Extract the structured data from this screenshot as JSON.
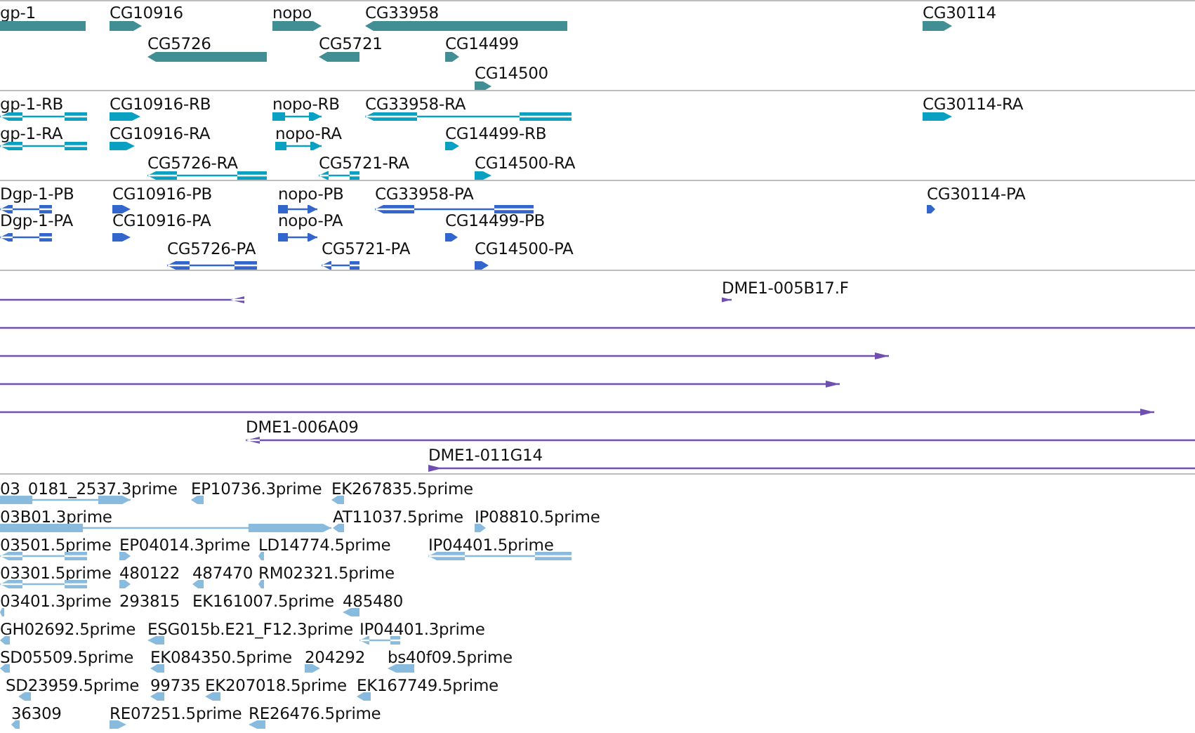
{
  "tracks": [
    {
      "kind": "genes",
      "color": "#418e94",
      "features": [
        {
          "label": "gp-1"
        },
        {
          "label": "CG10916",
          "reverse_strand": false
        },
        {
          "label": "nopo",
          "reverse_strand": false
        },
        {
          "label": "CG33958",
          "reverse_strand": true
        },
        {
          "label": "CG30114",
          "reverse_strand": false
        },
        {
          "label": "CG5726",
          "reverse_strand": true
        },
        {
          "label": "CG5721",
          "reverse_strand": true
        },
        {
          "label": "CG14499",
          "reverse_strand": false
        },
        {
          "label": "CG14500",
          "reverse_strand": false
        }
      ]
    },
    {
      "kind": "transcripts",
      "color": "#0aa0c2",
      "features": [
        {
          "label": "gp-1-RB",
          "reverse_strand": true
        },
        {
          "label": "CG10916-RB",
          "reverse_strand": false
        },
        {
          "label": "nopo-RB",
          "reverse_strand": false
        },
        {
          "label": "CG33958-RA",
          "reverse_strand": true
        },
        {
          "label": "CG30114-RA",
          "reverse_strand": false
        },
        {
          "label": "gp-1-RA",
          "reverse_strand": true
        },
        {
          "label": "CG10916-RA",
          "reverse_strand": false
        },
        {
          "label": "nopo-RA",
          "reverse_strand": false
        },
        {
          "label": "CG14499-RB",
          "reverse_strand": false
        },
        {
          "label": "CG5726-RA",
          "reverse_strand": true
        },
        {
          "label": "CG5721-RA",
          "reverse_strand": true
        },
        {
          "label": "CG14500-RA",
          "reverse_strand": false
        }
      ]
    },
    {
      "kind": "proteins",
      "color": "#3366cc",
      "features": [
        {
          "label": "Dgp-1-PB",
          "reverse_strand": true
        },
        {
          "label": "CG10916-PB",
          "reverse_strand": false
        },
        {
          "label": "nopo-PB",
          "reverse_strand": false
        },
        {
          "label": "CG33958-PA",
          "reverse_strand": true
        },
        {
          "label": "CG30114-PA",
          "reverse_strand": false
        },
        {
          "label": "Dgp-1-PA",
          "reverse_strand": true
        },
        {
          "label": "CG10916-PA",
          "reverse_strand": false
        },
        {
          "label": "nopo-PA",
          "reverse_strand": false
        },
        {
          "label": "CG14499-PB",
          "reverse_strand": false
        },
        {
          "label": "CG5726-PA",
          "reverse_strand": true
        },
        {
          "label": "CG5721-PA",
          "reverse_strand": true
        },
        {
          "label": "CG14500-PA",
          "reverse_strand": false
        }
      ]
    },
    {
      "kind": "clones",
      "color": "#6f4fb0",
      "features": [
        {
          "kind": "clone",
          "reverse_strand": true
        },
        {
          "kind": "clone",
          "label": "DME1-005B17.F",
          "reverse_strand": false
        },
        {
          "kind": "span"
        },
        {
          "kind": "clone",
          "reverse_strand": false
        },
        {
          "kind": "clone",
          "reverse_strand": false
        },
        {
          "kind": "clone",
          "reverse_strand": false
        },
        {
          "kind": "clone",
          "label": "DME1-006A09",
          "reverse_strand": true
        },
        {
          "kind": "clone",
          "label": "DME1-011G14",
          "reverse_strand": false
        }
      ]
    },
    {
      "kind": "ests",
      "color": "#88bbdd",
      "features": [
        {
          "label": "03_0181_2537.3prime",
          "reverse_strand": false
        },
        {
          "label": "EP10736.3prime",
          "reverse_strand": true
        },
        {
          "label": "EK267835.5prime",
          "reverse_strand": true
        },
        {
          "label": "03B01.3prime",
          "reverse_strand": false
        },
        {
          "label": "AT11037.5prime",
          "reverse_strand": true
        },
        {
          "label": "IP08810.5prime",
          "reverse_strand": false
        },
        {
          "label": "03501.5prime",
          "reverse_strand": true
        },
        {
          "label": "EP04014.3prime",
          "reverse_strand": false
        },
        {
          "label": "LD14774.5prime",
          "reverse_strand": true
        },
        {
          "label": "IP04401.5prime",
          "reverse_strand": true
        },
        {
          "label": "03301.5prime",
          "reverse_strand": true
        },
        {
          "label": "480122",
          "reverse_strand": false
        },
        {
          "label": "487470",
          "reverse_strand": true
        },
        {
          "label": "RM02321.5prime",
          "reverse_strand": true
        },
        {
          "label": "03401.3prime",
          "reverse_strand": true
        },
        {
          "label": "293815"
        },
        {
          "label": "EK161007.5prime"
        },
        {
          "label": "485480",
          "reverse_strand": true
        },
        {
          "label": "GH02692.5prime",
          "reverse_strand": true
        },
        {
          "label": "ESG015b.E21_F12.3prime",
          "reverse_strand": true
        },
        {
          "label": "IP04401.3prime",
          "reverse_strand": true
        },
        {
          "label": "SD05509.5prime",
          "reverse_strand": true
        },
        {
          "label": "EK084350.5prime",
          "reverse_strand": true
        },
        {
          "label": "204292",
          "reverse_strand": false
        },
        {
          "label": "bs40f09.5prime",
          "reverse_strand": true
        },
        {
          "label": "SD23959.5prime",
          "reverse_strand": true
        },
        {
          "label": "99735",
          "reverse_strand": true
        },
        {
          "label": "EK207018.5prime",
          "reverse_strand": true
        },
        {
          "label": "EK167749.5prime",
          "reverse_strand": true
        },
        {
          "label": "36309",
          "reverse_strand": true
        },
        {
          "label": "RE07251.5prime",
          "reverse_strand": false
        },
        {
          "label": "RE26476.5prime",
          "reverse_strand": true
        }
      ]
    }
  ]
}
